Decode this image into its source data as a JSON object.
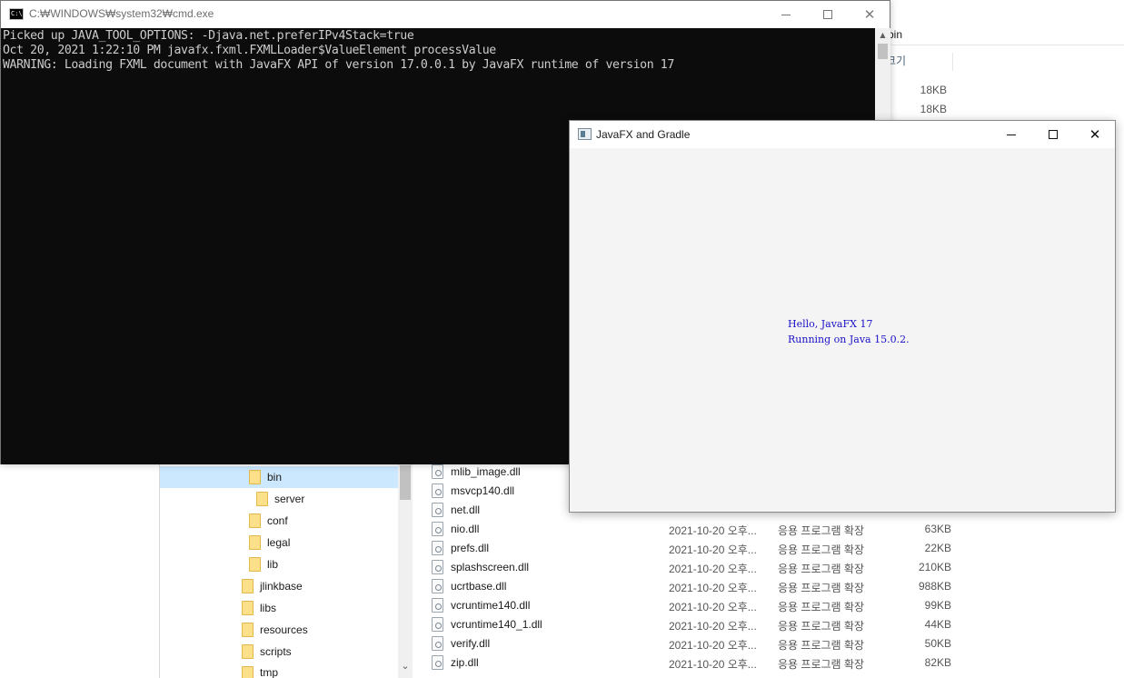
{
  "explorer": {
    "path": "bin",
    "column_header": "크기",
    "side_sizes": [
      "18KB",
      "18KB"
    ],
    "nav_items": [
      {
        "label": "bin",
        "selected": true
      },
      {
        "label": "server"
      },
      {
        "label": "conf"
      },
      {
        "label": "legal"
      },
      {
        "label": "lib"
      },
      {
        "label": "jlinkbase"
      },
      {
        "label": "libs"
      },
      {
        "label": "resources"
      },
      {
        "label": "scripts"
      },
      {
        "label": "tmp"
      }
    ],
    "files": [
      {
        "name": "mlib_image.dll",
        "date": "",
        "type": "",
        "size": ""
      },
      {
        "name": "msvcp140.dll",
        "date": "",
        "type": "",
        "size": ""
      },
      {
        "name": "net.dll",
        "date": "",
        "type": "",
        "size": ""
      },
      {
        "name": "nio.dll",
        "date": "2021-10-20 오후...",
        "type": "응용 프로그램 확장",
        "size": "63KB"
      },
      {
        "name": "prefs.dll",
        "date": "2021-10-20 오후...",
        "type": "응용 프로그램 확장",
        "size": "22KB"
      },
      {
        "name": "splashscreen.dll",
        "date": "2021-10-20 오후...",
        "type": "응용 프로그램 확장",
        "size": "210KB"
      },
      {
        "name": "ucrtbase.dll",
        "date": "2021-10-20 오후...",
        "type": "응용 프로그램 확장",
        "size": "988KB"
      },
      {
        "name": "vcruntime140.dll",
        "date": "2021-10-20 오후...",
        "type": "응용 프로그램 확장",
        "size": "99KB"
      },
      {
        "name": "vcruntime140_1.dll",
        "date": "2021-10-20 오후...",
        "type": "응용 프로그램 확장",
        "size": "44KB"
      },
      {
        "name": "verify.dll",
        "date": "2021-10-20 오후...",
        "type": "응용 프로그램 확장",
        "size": "50KB"
      },
      {
        "name": "zip.dll",
        "date": "2021-10-20 오후...",
        "type": "응용 프로그램 확장",
        "size": "82KB"
      }
    ]
  },
  "cmd": {
    "title": "C:₩WINDOWS₩system32₩cmd.exe",
    "icon_text": "C:\\",
    "lines": [
      "Picked up JAVA_TOOL_OPTIONS: -Djava.net.preferIPv4Stack=true",
      "Oct 20, 2021 1:22:10 PM javafx.fxml.FXMLLoader$ValueElement processValue",
      "WARNING: Loading FXML document with JavaFX API of version 17.0.0.1 by JavaFX runtime of version 17"
    ],
    "scroll_up": "▲"
  },
  "fx": {
    "title": "JavaFX and Gradle",
    "line1": "Hello, JavaFX 17",
    "line2": "Running on Java 15.0.2."
  },
  "buttons": {
    "close": "✕",
    "scroll_down": "⌄"
  }
}
